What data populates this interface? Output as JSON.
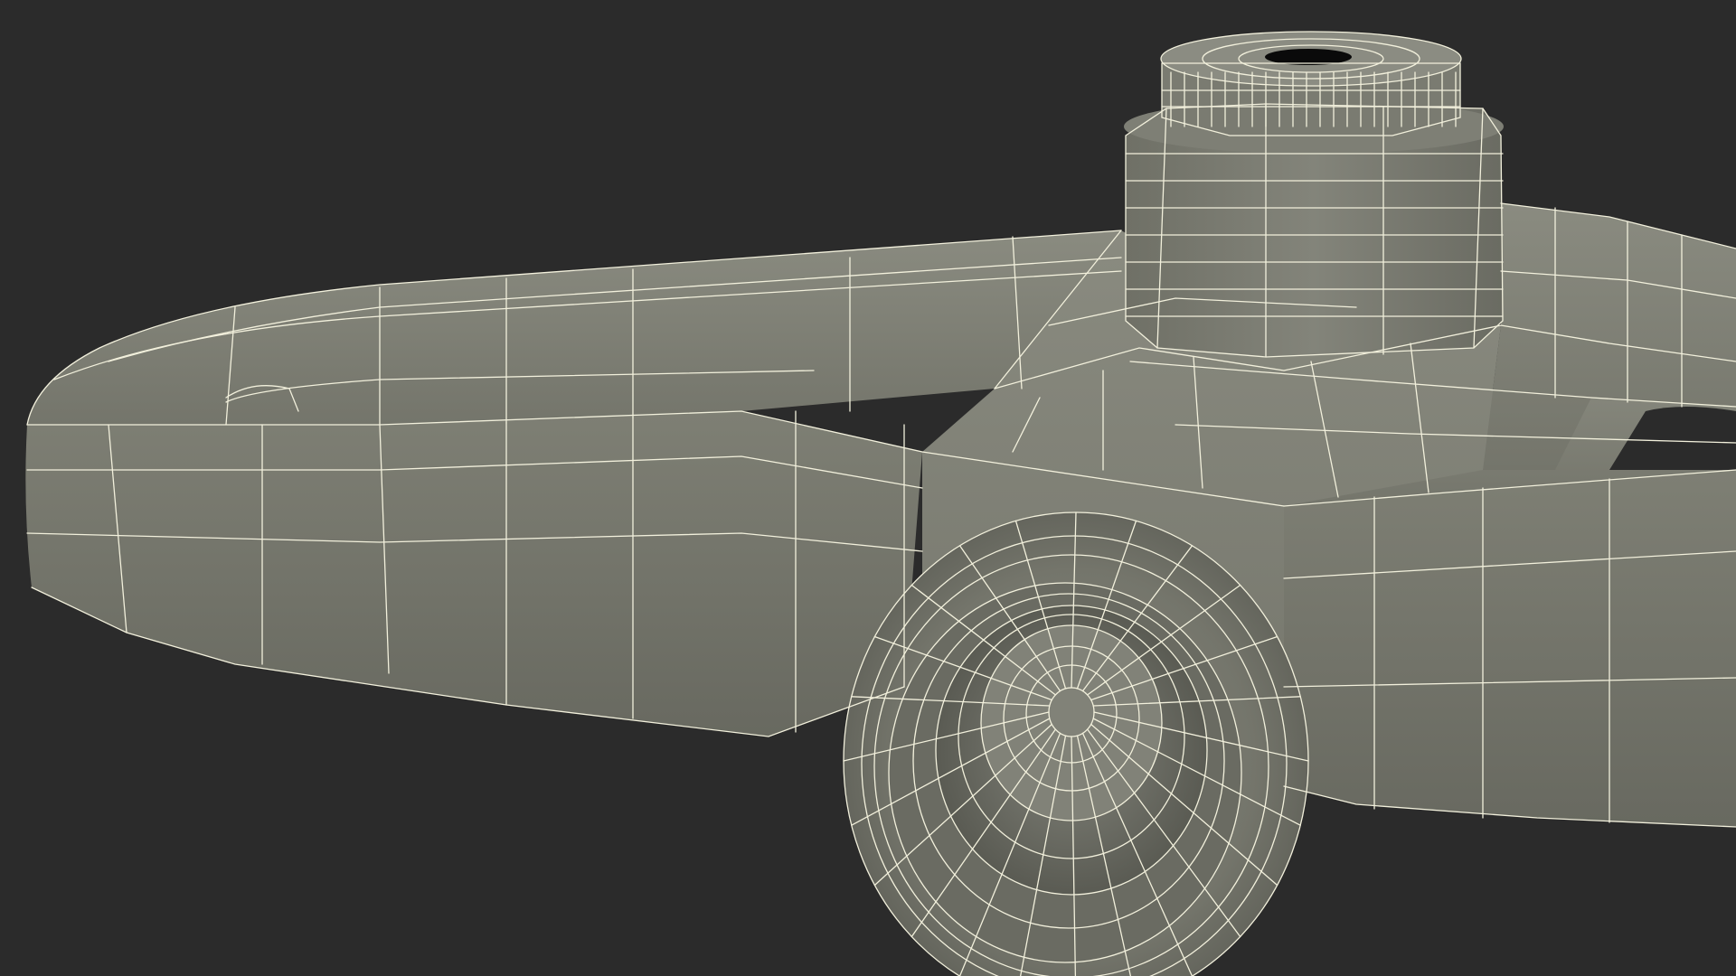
{
  "scene": {
    "background_color": "#2b2b2b",
    "surface_color": "#7b7c71",
    "surface_dark": "#62635a",
    "surface_light": "#8c8d82",
    "wire_color": "#f2f0dc",
    "hole_color": "#0a0a0a"
  }
}
